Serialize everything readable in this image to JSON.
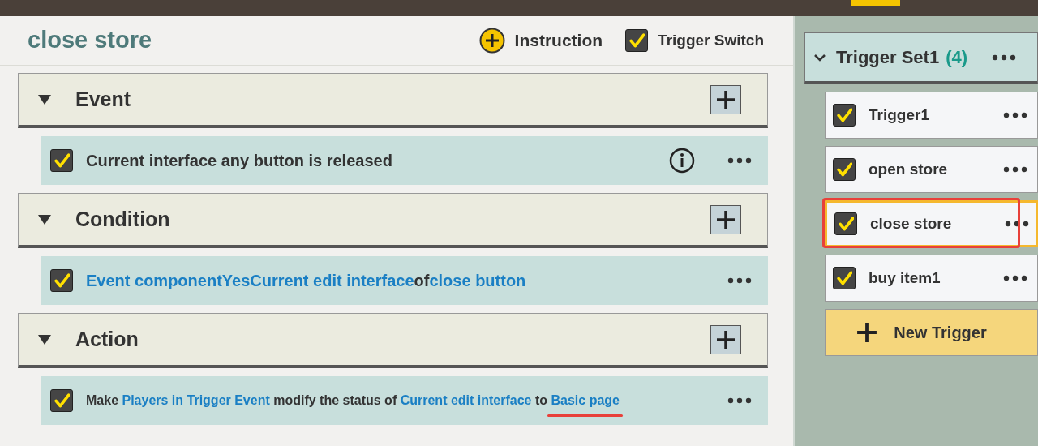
{
  "editor": {
    "title": "close store",
    "instruction_button": "Instruction",
    "trigger_switch": {
      "label": "Trigger Switch",
      "checked": true
    }
  },
  "sections": [
    {
      "title": "Event",
      "expanded": true,
      "statements": [
        {
          "checked": true,
          "info": true,
          "small": false,
          "segments": [
            {
              "kind": "plain",
              "text": "Current interface any button is released"
            }
          ]
        }
      ]
    },
    {
      "title": "Condition",
      "expanded": true,
      "statements": [
        {
          "checked": true,
          "info": false,
          "small": false,
          "segments": [
            {
              "kind": "param",
              "text": "Event componentYesCurrent edit interface"
            },
            {
              "kind": "plain",
              "text": "of"
            },
            {
              "kind": "param",
              "text": "close button"
            }
          ]
        }
      ]
    },
    {
      "title": "Action",
      "expanded": true,
      "statements": [
        {
          "checked": true,
          "info": false,
          "small": true,
          "segments": [
            {
              "kind": "plain",
              "text": "Make "
            },
            {
              "kind": "param",
              "text": "Players in Trigger Event"
            },
            {
              "kind": "plain",
              "text": " modify the status of "
            },
            {
              "kind": "param",
              "text": "Current edit interface"
            },
            {
              "kind": "plain",
              "text": " to "
            },
            {
              "kind": "param",
              "text": "Basic page",
              "underlined": true
            }
          ]
        }
      ]
    }
  ],
  "trigger_set": {
    "name": "Trigger Set1",
    "count": "(4)",
    "expanded": true,
    "triggers": [
      {
        "name": "Trigger1",
        "checked": true,
        "selected": false,
        "highlighted": false
      },
      {
        "name": "open store",
        "checked": true,
        "selected": false,
        "highlighted": false
      },
      {
        "name": "close store",
        "checked": true,
        "selected": true,
        "highlighted": true
      },
      {
        "name": "buy item1",
        "checked": true,
        "selected": false,
        "highlighted": false
      }
    ],
    "new_button": "New Trigger"
  }
}
